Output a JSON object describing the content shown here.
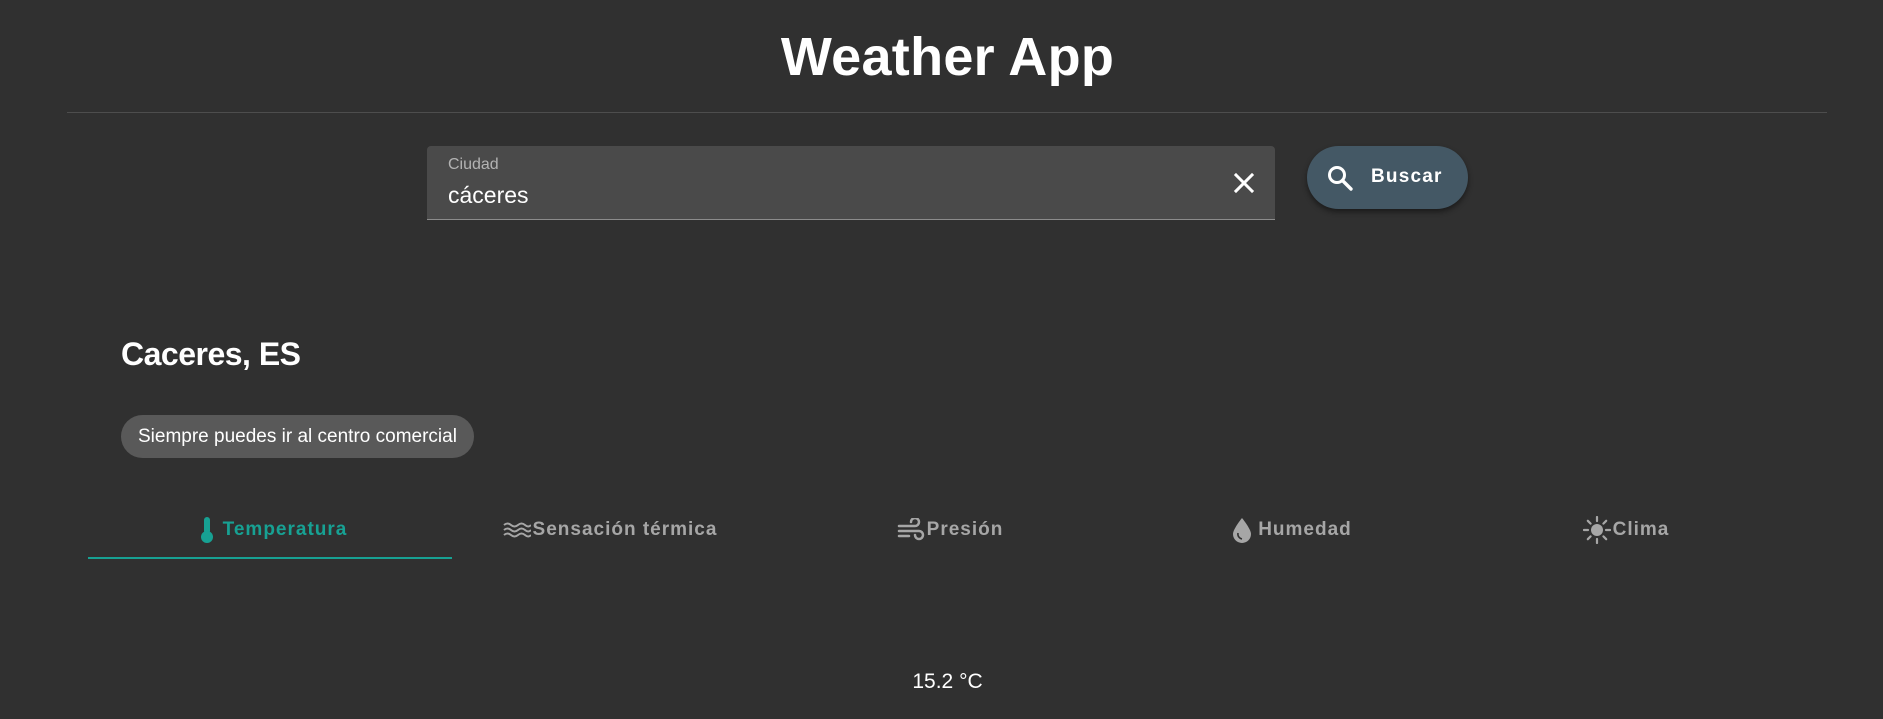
{
  "header": {
    "title": "Weather App"
  },
  "search": {
    "label": "Ciudad",
    "value": "cáceres",
    "clear_icon": "close-icon",
    "button_label": "Buscar",
    "button_icon": "search-icon"
  },
  "location": {
    "city": "Caceres, ES",
    "message": "Siempre puedes ir al centro comercial"
  },
  "tabs": [
    {
      "label": "Temperatura",
      "icon": "thermometer-icon",
      "active": true
    },
    {
      "label": "Sensación térmica",
      "icon": "waves-icon",
      "active": false
    },
    {
      "label": "Presión",
      "icon": "wind-icon",
      "active": false
    },
    {
      "label": "Humedad",
      "icon": "water-drop-icon",
      "active": false
    },
    {
      "label": "Clima",
      "icon": "sun-icon",
      "active": false
    }
  ],
  "reading": {
    "value": "15.2 °C"
  },
  "colors": {
    "background": "#303030",
    "accent": "#17a193",
    "button": "#445865",
    "chip": "#595959",
    "field": "#4a4a4a"
  }
}
